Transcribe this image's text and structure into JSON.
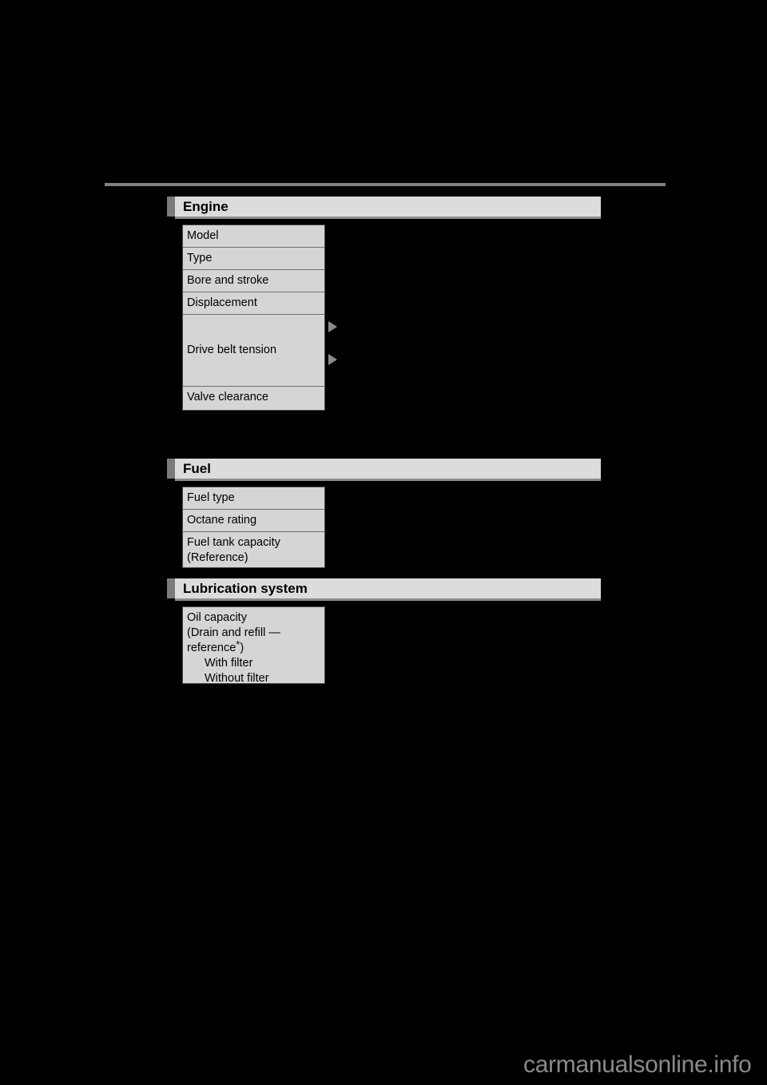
{
  "page": {
    "background_color": "#000000",
    "rule_color": "#828282",
    "header_bar_color": "#dcdcdc",
    "header_tab_color": "#7b7b7b",
    "table_cell_color": "#d5d5d5",
    "marker_color": "#8c8c8c",
    "watermark": "carmanualsonline.info"
  },
  "sections": [
    {
      "id": "engine",
      "title": "Engine",
      "rows": [
        {
          "label": "Model"
        },
        {
          "label": "Type"
        },
        {
          "label": "Bore and stroke"
        },
        {
          "label": "Displacement"
        },
        {
          "label": "Drive belt tension",
          "markers": 2
        },
        {
          "label": "Valve clearance"
        }
      ]
    },
    {
      "id": "fuel",
      "title": "Fuel",
      "rows": [
        {
          "label": "Fuel type"
        },
        {
          "label": "Octane rating"
        },
        {
          "label": "Fuel tank capacity",
          "label_line2": "(Reference)"
        }
      ]
    },
    {
      "id": "lubrication",
      "title": "Lubrication system",
      "rows": [
        {
          "label": "Oil capacity",
          "label_line2": "(Drain and refill —",
          "label_line3_pre": "reference",
          "label_line3_star": "*",
          "label_line3_post": ")",
          "sub_items": [
            "With filter",
            "Without filter"
          ]
        }
      ]
    }
  ]
}
